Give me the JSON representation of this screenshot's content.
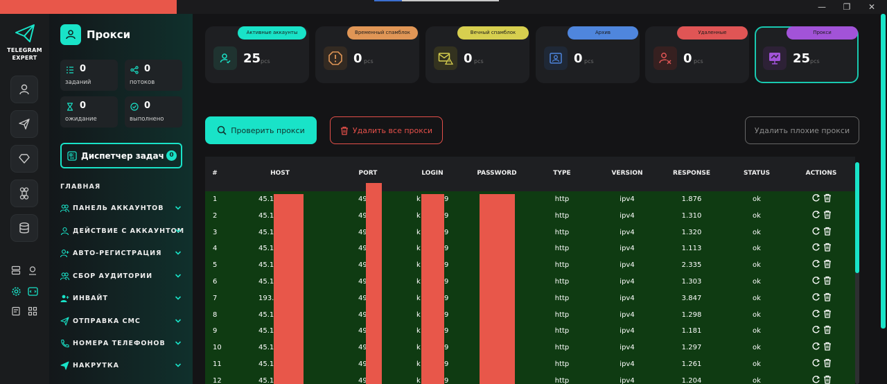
{
  "window": {
    "minimize_glyph": "—",
    "maximize_glyph": "❐",
    "close_glyph": "✕"
  },
  "app": {
    "logo_line1": "TELEGRAM",
    "logo_line2": "EXPERT",
    "page_title": "Прокси"
  },
  "rail": {
    "icons": [
      "user-icon",
      "send-icon",
      "diamond-icon",
      "command-icon",
      "database-icon"
    ],
    "mini_icons": [
      "server-icon",
      "map-pin-icon",
      "settings-icon",
      "code-icon",
      "document-icon",
      "apps-icon"
    ]
  },
  "stats": [
    {
      "value": "0",
      "label": "заданий",
      "icon": "list-icon"
    },
    {
      "value": "0",
      "label": "потоков",
      "icon": "share-icon"
    },
    {
      "value": "0",
      "label": "ожидание",
      "icon": "hourglass-icon"
    },
    {
      "value": "0",
      "label": "выполнено",
      "icon": "check-circle-icon"
    }
  ],
  "dispatcher": {
    "label": "Диспетчер задач",
    "count": "0"
  },
  "section_title": "ГЛАВНАЯ",
  "nav": [
    {
      "label": "ПАНЕЛЬ АККАУНТОВ",
      "icon": "users-icon"
    },
    {
      "label": "ДЕЙСТВИЕ С АККАУНТОМ",
      "icon": "user-icon"
    },
    {
      "label": "АВТО-РЕГИСТРАЦИЯ",
      "icon": "user-plus-icon"
    },
    {
      "label": "СБОР АУДИТОРИИ",
      "icon": "users-icon"
    },
    {
      "label": "ИНВАЙТ",
      "icon": "user-plus-icon"
    },
    {
      "label": "ОТПРАВКА СМС",
      "icon": "send-icon"
    },
    {
      "label": "НОМЕРА ТЕЛЕФОНОВ",
      "icon": "phone-icon"
    },
    {
      "label": "НАКРУТКА",
      "icon": "send-icon"
    }
  ],
  "cards": [
    {
      "label": "Активные аккаунты",
      "value": "25",
      "unit": "pcs",
      "color": "#19e3c8",
      "icon": "user-check-icon"
    },
    {
      "label": "Временный спамблок",
      "value": "0",
      "unit": "pcs",
      "color": "#e09656",
      "icon": "alert-octagon-icon"
    },
    {
      "label": "Вечный спамблок",
      "value": "0",
      "unit": "pcs",
      "color": "#d7cf4f",
      "icon": "mail-warning-icon"
    },
    {
      "label": "Архив",
      "value": "0",
      "unit": "pcs",
      "color": "#4f86dd",
      "icon": "archive-user-icon"
    },
    {
      "label": "Удаленные",
      "value": "0",
      "unit": "pcs",
      "color": "#e05555",
      "icon": "user-x-icon"
    },
    {
      "label": "Прокси",
      "value": "25",
      "unit": "pcs",
      "color": "#a253d8",
      "icon": "proxy-monitor-icon"
    }
  ],
  "buttons": {
    "check": "Проверить прокси",
    "delete_all": "Удалить все прокси",
    "delete_bad": "Удалить плохие прокси"
  },
  "table": {
    "headers": [
      "#",
      "HOST",
      "PORT",
      "LOGIN",
      "PASSWORD",
      "TYPE",
      "VERSION",
      "RESPONSE",
      "STATUS",
      "ACTIONS"
    ],
    "rows": [
      {
        "n": "1",
        "host": "45.1",
        "port": "49",
        "login": "k",
        "login2": "9",
        "pass_end": "",
        "type": "http",
        "version": "ipv4",
        "response": "1.876",
        "status": "ok"
      },
      {
        "n": "2",
        "host": "45.1",
        "port": "49",
        "login": "k",
        "login2": "9",
        "pass_end": "",
        "type": "http",
        "version": "ipv4",
        "response": "1.310",
        "status": "ok"
      },
      {
        "n": "3",
        "host": "45.1",
        "port": "49",
        "login": "k",
        "login2": "9",
        "pass_end": "",
        "type": "http",
        "version": "ipv4",
        "response": "1.320",
        "status": "ok"
      },
      {
        "n": "4",
        "host": "45.1",
        "port": "49",
        "login": "k",
        "login2": "9",
        "pass_end": "",
        "type": "http",
        "version": "ipv4",
        "response": "1.113",
        "status": "ok"
      },
      {
        "n": "5",
        "host": "45.1",
        "port": "49",
        "login": "k",
        "login2": "9",
        "pass_end": "",
        "type": "http",
        "version": "ipv4",
        "response": "2.335",
        "status": "ok"
      },
      {
        "n": "6",
        "host": "45.1",
        "port": "49",
        "login": "k",
        "login2": "9",
        "pass_end": "",
        "type": "http",
        "version": "ipv4",
        "response": "1.303",
        "status": "ok"
      },
      {
        "n": "7",
        "host": "193.3",
        "port": "49",
        "login": "k",
        "login2": "9",
        "pass_end": "",
        "type": "http",
        "version": "ipv4",
        "response": "3.847",
        "status": "ok"
      },
      {
        "n": "8",
        "host": "45.19",
        "port": "49",
        "login": "k",
        "login2": "9",
        "pass_end": "",
        "type": "http",
        "version": "ipv4",
        "response": "1.298",
        "status": "ok"
      },
      {
        "n": "9",
        "host": "45.1",
        "port": "49",
        "login": "k",
        "login2": "9",
        "pass_end": "",
        "type": "http",
        "version": "ipv4",
        "response": "1.181",
        "status": "ok"
      },
      {
        "n": "10",
        "host": "45.1",
        "port": "49",
        "login": "k",
        "login2": "9",
        "pass_end": "",
        "type": "http",
        "version": "ipv4",
        "response": "1.297",
        "status": "ok"
      },
      {
        "n": "11",
        "host": "45.1",
        "port": "49",
        "login": "k",
        "login2": "9",
        "pass_end": "",
        "type": "http",
        "version": "ipv4",
        "response": "1.261",
        "status": "ok"
      },
      {
        "n": "12",
        "host": "45.1",
        "port": "49",
        "login": "k",
        "login2": "9",
        "pass_end": "",
        "type": "http",
        "version": "ipv4",
        "response": "1.204",
        "status": "ok"
      }
    ]
  }
}
